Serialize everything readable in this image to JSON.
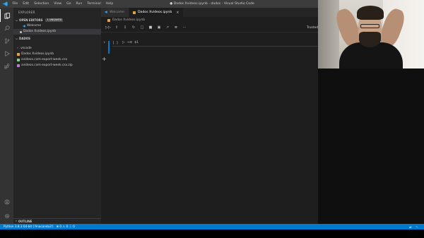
{
  "titlebar": {
    "menu": [
      "File",
      "Edit",
      "Selection",
      "View",
      "Go",
      "Run",
      "Terminal",
      "Help"
    ],
    "window_title": "● Dados Xvideos.ipynb - dados - Visual Studio Code"
  },
  "sidebar": {
    "title": "EXPLORER",
    "open_editors": {
      "label": "OPEN EDITORS",
      "badge": "1 UNSAVED"
    },
    "open_editor_items": [
      {
        "label": "Welcome"
      },
      {
        "label": "Dados Xvideos.ipynb"
      }
    ],
    "folder": {
      "label": "DADOS"
    },
    "files": [
      {
        "label": ".vscode"
      },
      {
        "label": "Dados Xvideos.ipynb"
      },
      {
        "label": "xvideos.com-export-week.csv"
      },
      {
        "label": "xvideos.com-export-week.csv.zip"
      }
    ],
    "outline": "OUTLINE"
  },
  "editor": {
    "tabs": [
      {
        "label": "Welcome",
        "active": false
      },
      {
        "label": "Dados Xvideos.ipynb",
        "active": true
      }
    ],
    "breadcrumb": "Dados Xvideos.ipynb",
    "trusted_label": "Trusted",
    "cell": {
      "prompt": "[ ]",
      "language": "$1"
    }
  },
  "statusbar": {
    "interpreter": "Python 3.8.3 64-bit ('Anaconda3')",
    "errors": "0",
    "warnings": "0",
    "info": "0"
  },
  "colors": {
    "accent": "#007acc",
    "titlebar": "#3c3c3c",
    "activitybar": "#333333",
    "sidebar": "#252526",
    "editor": "#1e1e1e"
  }
}
